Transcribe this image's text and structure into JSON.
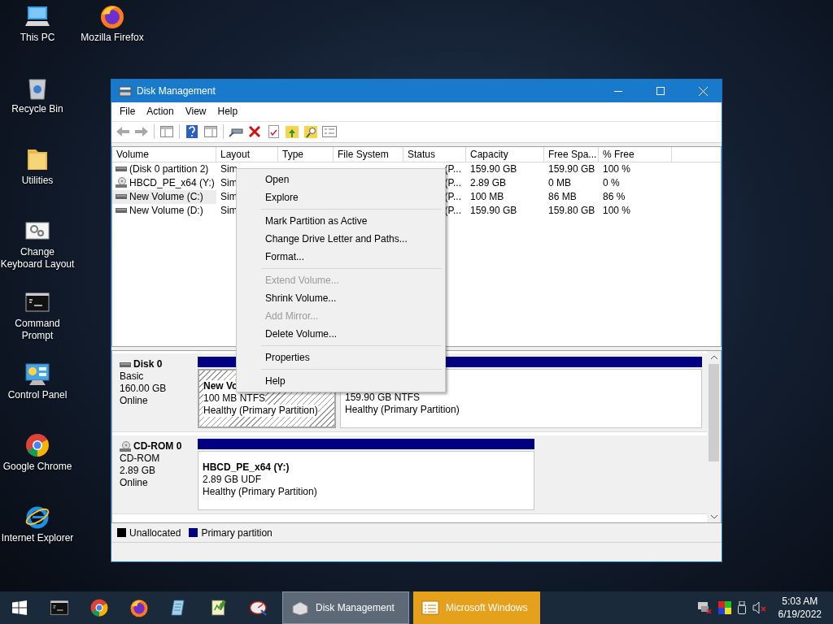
{
  "desktop_icons": [
    {
      "label": "This PC",
      "kind": "pc"
    },
    {
      "label": "Mozilla Firefox",
      "kind": "firefox"
    },
    {
      "label": "Recycle Bin",
      "kind": "bin"
    },
    {
      "label": "Utilities",
      "kind": "folder"
    },
    {
      "label": "Change Keyboard Layout",
      "kind": "settings"
    },
    {
      "label": "Command Prompt",
      "kind": "terminal"
    },
    {
      "label": "Control Panel",
      "kind": "panel"
    },
    {
      "label": "Google Chrome",
      "kind": "chrome"
    },
    {
      "label": "Internet Explorer",
      "kind": "ie"
    }
  ],
  "window": {
    "title": "Disk Management",
    "menu": [
      "File",
      "Action",
      "View",
      "Help"
    ],
    "volume_table": {
      "columns": [
        "Volume",
        "Layout",
        "Type",
        "File System",
        "Status",
        "Capacity",
        "Free Spa...",
        "% Free"
      ],
      "rows": [
        {
          "kind": "disk",
          "volume": "(Disk 0 partition 2)",
          "layout": "Sim",
          "status": "(P...",
          "capacity": "159.90 GB",
          "free_space": "159.90 GB",
          "percent_free": "100 %",
          "selected": false
        },
        {
          "kind": "cdrom",
          "volume": "HBCD_PE_x64 (Y:)",
          "layout": "Sim",
          "status": "(P...",
          "capacity": "2.89 GB",
          "free_space": "0 MB",
          "percent_free": "0 %",
          "selected": false
        },
        {
          "kind": "disk",
          "volume": "New Volume (C:)",
          "layout": "Sim",
          "status": "(P...",
          "capacity": "100 MB",
          "free_space": "86 MB",
          "percent_free": "86 %",
          "selected": true
        },
        {
          "kind": "disk",
          "volume": "New Volume (D:)",
          "layout": "Sim",
          "status": "(P...",
          "capacity": "159.90 GB",
          "free_space": "159.80 GB",
          "percent_free": "100 %",
          "selected": false
        }
      ]
    },
    "disks": [
      {
        "kind": "disk",
        "name": "Disk 0",
        "type": "Basic",
        "size": "160.00 GB",
        "state": "Online",
        "partitions": [
          {
            "name": "New Vo",
            "detail": "100 MB NTFS",
            "status": "Healthy (Primary Partition)",
            "selected": true
          },
          {
            "detail": "159.90 GB NTFS",
            "status": "Healthy (Primary Partition)",
            "selected": false
          }
        ]
      },
      {
        "kind": "cdrom",
        "name": "CD-ROM 0",
        "type": "CD-ROM",
        "size": "2.89 GB",
        "state": "Online",
        "partitions": [
          {
            "name": "HBCD_PE_x64  (Y:)",
            "detail": "2.89 GB UDF",
            "status": "Healthy (Primary Partition)",
            "selected": false
          }
        ]
      }
    ],
    "legend": [
      {
        "label": "Unallocated",
        "color": "#000000"
      },
      {
        "label": "Primary partition",
        "color": "#000080"
      }
    ]
  },
  "context_menu": [
    {
      "kind": "item",
      "label": "Open",
      "disabled": false
    },
    {
      "kind": "item",
      "label": "Explore",
      "disabled": false
    },
    {
      "kind": "separator"
    },
    {
      "kind": "item",
      "label": "Mark Partition as Active",
      "disabled": false
    },
    {
      "kind": "item",
      "label": "Change Drive Letter and Paths...",
      "disabled": false
    },
    {
      "kind": "item",
      "label": "Format...",
      "disabled": false
    },
    {
      "kind": "separator"
    },
    {
      "kind": "item",
      "label": "Extend Volume...",
      "disabled": true
    },
    {
      "kind": "item",
      "label": "Shrink Volume...",
      "disabled": false
    },
    {
      "kind": "item",
      "label": "Add Mirror...",
      "disabled": true
    },
    {
      "kind": "item",
      "label": "Delete Volume...",
      "disabled": false
    },
    {
      "kind": "separator"
    },
    {
      "kind": "item",
      "label": "Properties",
      "disabled": false
    },
    {
      "kind": "separator"
    },
    {
      "kind": "item",
      "label": "Help",
      "disabled": false
    }
  ],
  "taskbar": {
    "pinned": [
      {
        "kind": "terminal"
      },
      {
        "kind": "chrome"
      },
      {
        "kind": "firefox"
      },
      {
        "kind": "notepad"
      },
      {
        "kind": "editor"
      },
      {
        "kind": "disk-tool"
      }
    ],
    "tasks": [
      {
        "label": "Disk Management",
        "selected": true,
        "attention": false
      },
      {
        "label": "Microsoft Windows",
        "selected": false,
        "attention": true
      }
    ],
    "clock": {
      "time": "5:03 AM",
      "date": "6/19/2022"
    }
  }
}
